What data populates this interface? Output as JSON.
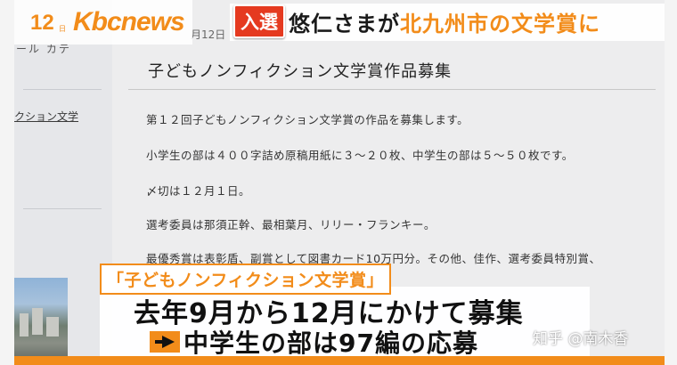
{
  "broadcast": {
    "channel_number": "12",
    "channel_small": "日",
    "logo_text": "Kbcnews",
    "badge": "入選",
    "headline_part1": "悠仁さまが",
    "headline_part2": "北九州市の文学賞に"
  },
  "website": {
    "sidebar_fragment": "ール カテ",
    "sidebar_link": "クション文学",
    "date_fragment": "月12日",
    "title": "子どもノンフィクション文学賞作品募集",
    "paragraphs": [
      "第１２回子どもノンフィクション文学賞の作品を募集します。",
      "小学生の部は４００字詰め原稿用紙に３～２０枚、中学生の部は５～５０枚です。",
      "〆切は１２月１日。",
      "選考委員は那須正幹、最相葉月、リリー・フランキー。",
      "最優秀賞は表彰盾、副賞として図書カード10万円分。その他、佳作、選考委員特別賞、"
    ]
  },
  "captions": {
    "label": "「子どもノンフィクション文学賞」",
    "line1": "去年9月から12月にかけて募集",
    "line2": "中学生の部は97編の応募"
  },
  "watermark": "知乎 @南木香",
  "colors": {
    "accent": "#f28c1a",
    "badge": "#e53a20"
  }
}
